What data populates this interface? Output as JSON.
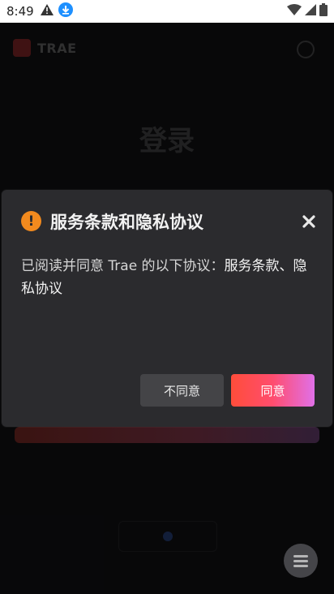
{
  "status_bar": {
    "time": "8:49",
    "icons_left": [
      "warning-icon",
      "download-icon"
    ],
    "icons_right": [
      "wifi-icon",
      "signal-icon",
      "battery-icon"
    ]
  },
  "background_app": {
    "logo_text": "TRAE",
    "title": "登录"
  },
  "dialog": {
    "title": "服务条款和隐私协议",
    "body_prefix": "已阅读并同意 Trae 的以下协议：",
    "body_links": "服务条款、隐私协议",
    "disagree_label": "不同意",
    "agree_label": "同意",
    "warning_glyph": "!",
    "colors": {
      "warning": "#f28a1e",
      "agree_gradient_start": "#ff4d3a",
      "agree_gradient_end": "#e070e8"
    }
  }
}
